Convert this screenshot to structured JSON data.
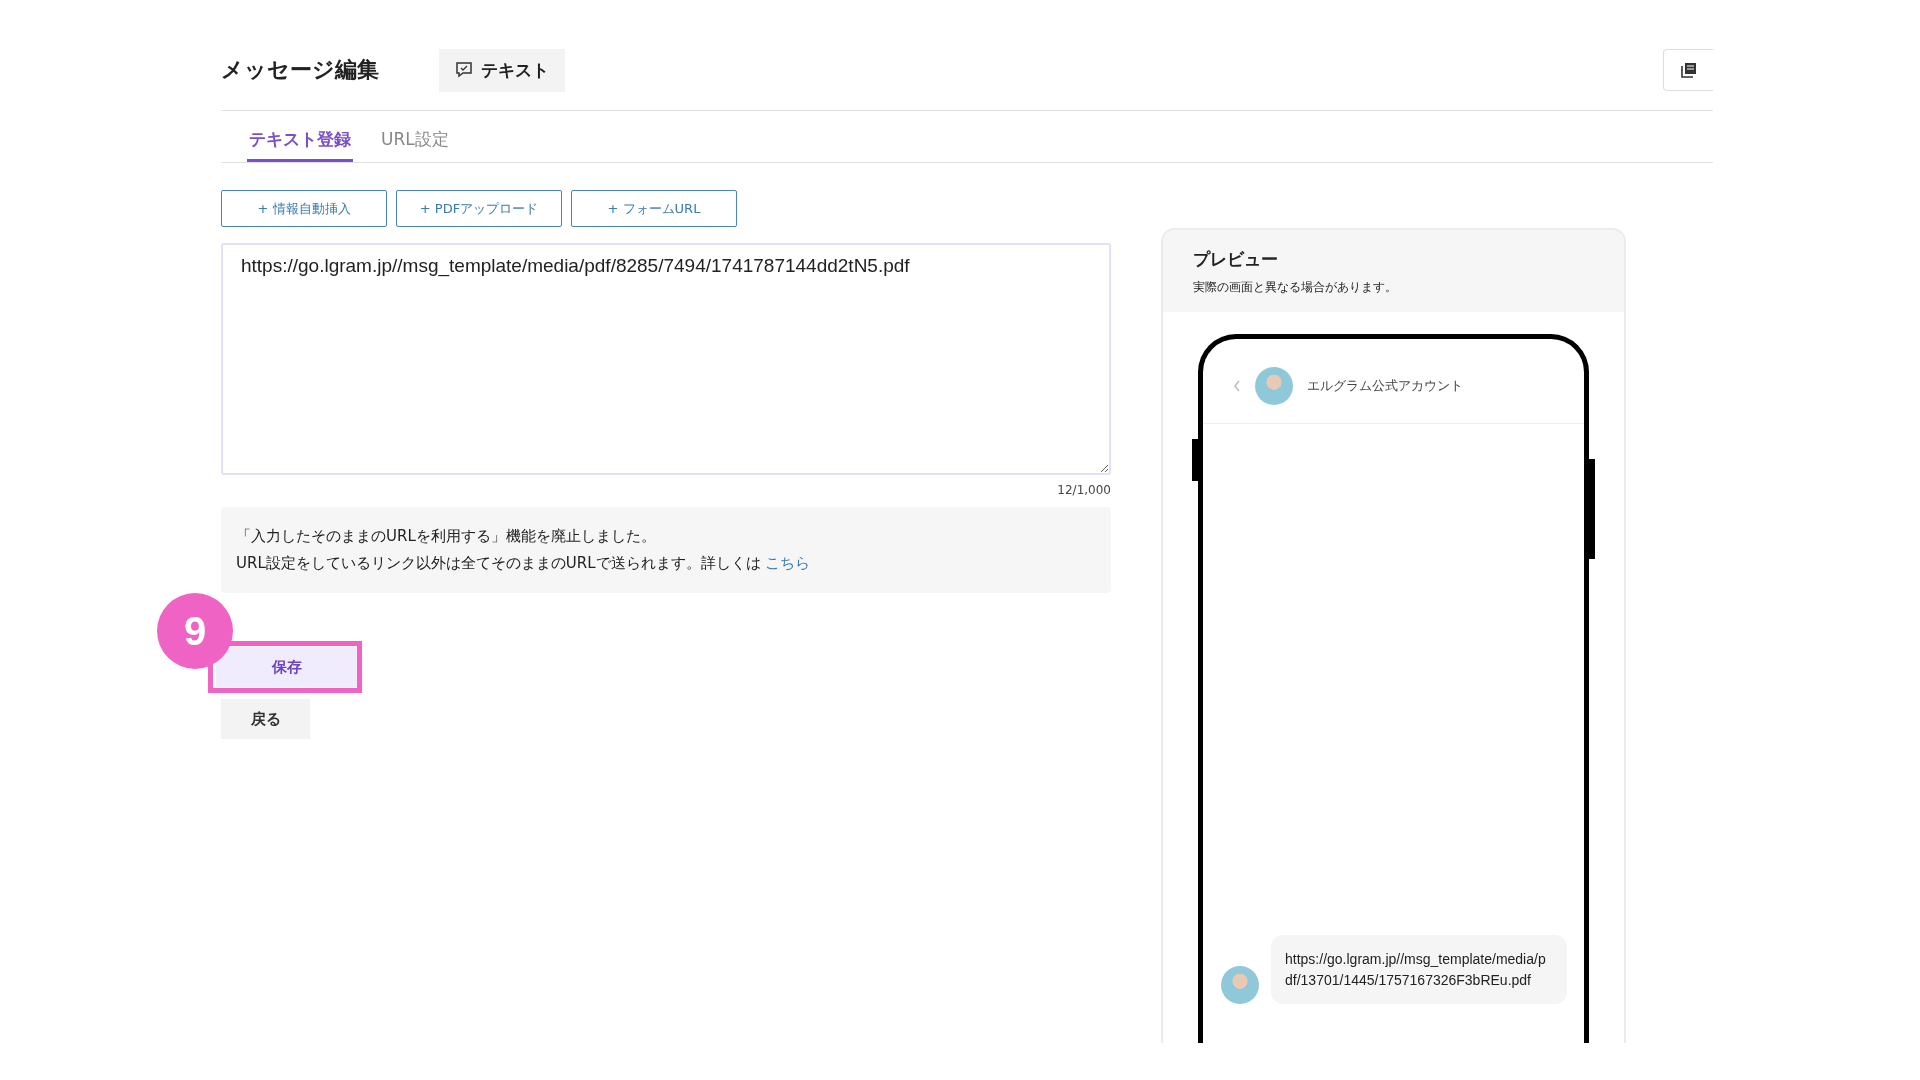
{
  "header": {
    "title": "メッセージ編集",
    "type_chip": "テキスト"
  },
  "tabs": [
    {
      "label": "テキスト登録",
      "selected": true
    },
    {
      "label": "URL設定",
      "selected": false
    }
  ],
  "insert_buttons": [
    "+ 情報自動挿入",
    "+ PDFアップロード",
    "+ フォームURL"
  ],
  "editor": {
    "value": "https://go.lgram.jp//msg_template/media/pdf/8285/7494/1741787144dd2tN5.pdf",
    "counter": "12/1,000"
  },
  "notice": {
    "line_1": "「入力したそのままのURLを利用する」機能を廃止しました。",
    "line_2": "URL設定をしているリンク以外は全てそのままのURLで送られます。詳しくは",
    "link": "こちら"
  },
  "step_marker": "9",
  "actions": {
    "save": "保存",
    "back": "戻る"
  },
  "preview": {
    "title": "プレビュー",
    "note": "実際の画面と異なる場合があります。",
    "account_name": "エルグラム公式アカウント",
    "message": "https://go.lgram.jp//msg_template/media/pdf/13701/1445/1757167326F3bREu.pdf"
  }
}
